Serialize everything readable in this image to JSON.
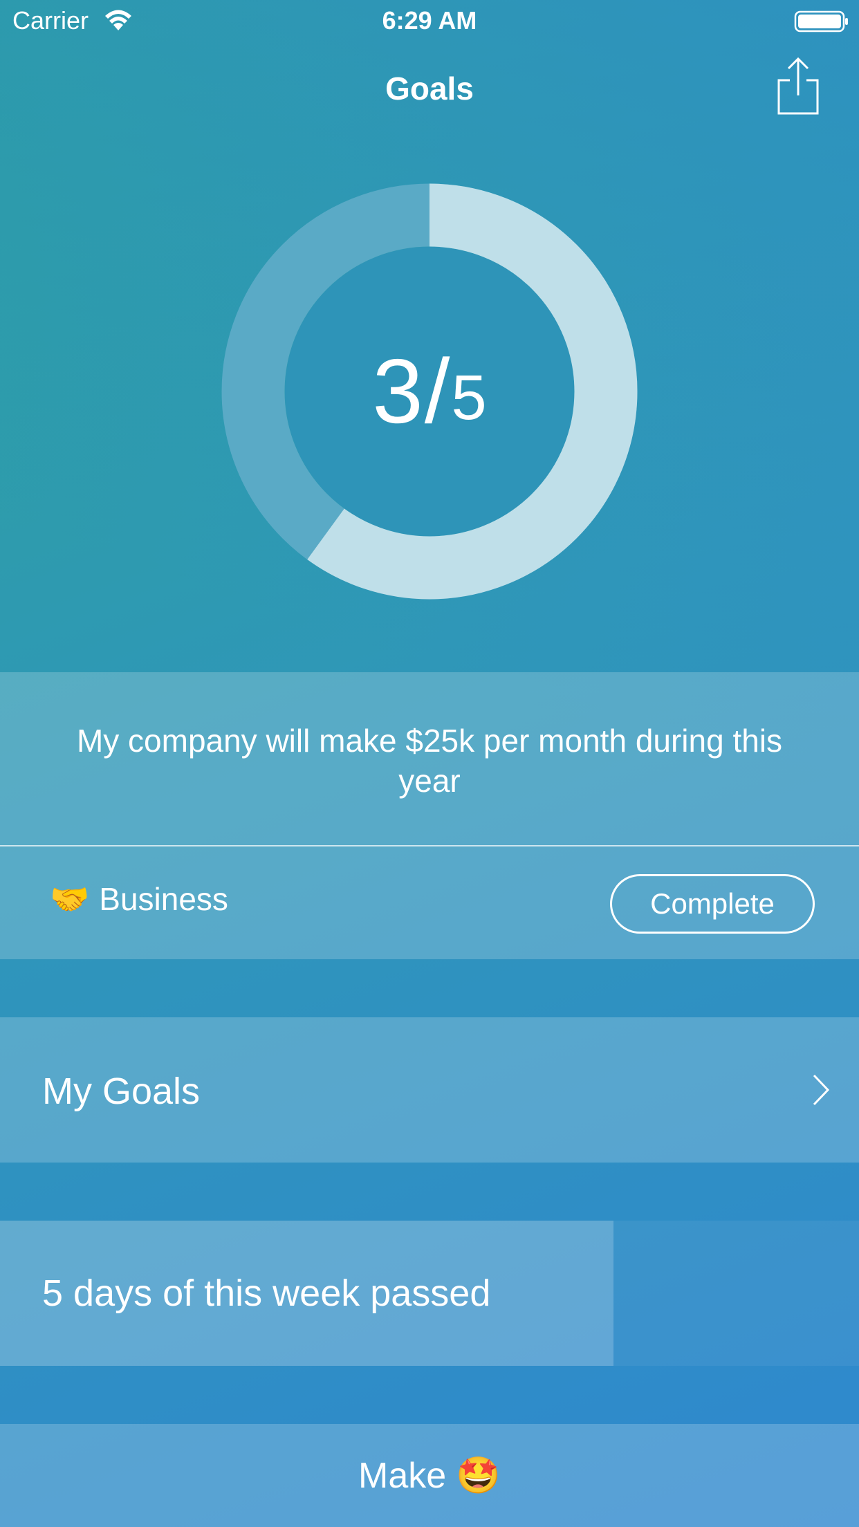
{
  "status_bar": {
    "carrier": "Carrier",
    "time": "6:29 AM",
    "wifi_icon": "wifi-icon",
    "battery_icon": "battery-full-icon"
  },
  "nav": {
    "title": "Goals",
    "share_icon": "share-icon"
  },
  "progress": {
    "completed": "3",
    "separator": "/",
    "total": "5",
    "completed_fraction": 0.6,
    "ring_filled_color": "#bfdfe9",
    "ring_track_color": "#5aaac6",
    "ring_inner_color": "#2e94b8"
  },
  "goal": {
    "text": "My company will make $25k per month during this year",
    "category_icon": "🤝",
    "category": "Business",
    "complete_label": "Complete"
  },
  "my_goals": {
    "label": "My Goals",
    "chevron_icon": "chevron-right-icon"
  },
  "week": {
    "label": "5 days of this week passed",
    "passed_fraction": 0.714
  },
  "bottom": {
    "label": "Make",
    "emoji": "🤩"
  }
}
